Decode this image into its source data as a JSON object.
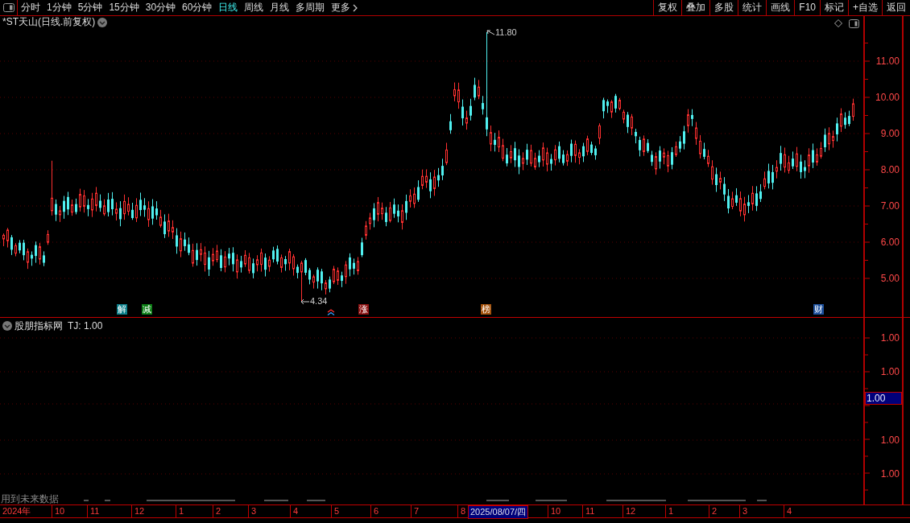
{
  "toolbar": {
    "periods": [
      {
        "label": "分时",
        "selected": false
      },
      {
        "label": "1分钟",
        "selected": false
      },
      {
        "label": "5分钟",
        "selected": false
      },
      {
        "label": "15分钟",
        "selected": false
      },
      {
        "label": "30分钟",
        "selected": false
      },
      {
        "label": "60分钟",
        "selected": false
      },
      {
        "label": "日线",
        "selected": true
      },
      {
        "label": "周线",
        "selected": false
      },
      {
        "label": "月线",
        "selected": false
      },
      {
        "label": "多周期",
        "selected": false
      }
    ],
    "more": "更多",
    "tools": [
      "复权",
      "叠加",
      "多股",
      "统计",
      "画线",
      "F10",
      "标记",
      "+自选",
      "返回"
    ]
  },
  "main_panel": {
    "title": "*ST天山(日线.前复权)",
    "price_axis": [
      "11.00",
      "10.00",
      "9.00",
      "8.00",
      "7.00",
      "6.00",
      "5.00"
    ],
    "high_marker": "11.80",
    "low_marker": "4.34",
    "events": [
      {
        "label": "解",
        "color": "#0b7f8a"
      },
      {
        "label": "减",
        "color": "#0b7d14"
      },
      {
        "label": "涨",
        "color": "#8a1010"
      },
      {
        "label": "榜",
        "color": "#a4520c"
      },
      {
        "label": "财",
        "color": "#1c4f9c"
      }
    ]
  },
  "indicator_panel": {
    "title": "股朋指标网",
    "reading": "TJ: 1.00",
    "axis": [
      "1.00",
      "1.00",
      "1.00",
      "1.00"
    ],
    "current": "1.00"
  },
  "footer_note": "用到未来数据",
  "date_axis": [
    {
      "label": "2024年",
      "selected": false
    },
    {
      "label": "10",
      "selected": false
    },
    {
      "label": "11",
      "selected": false
    },
    {
      "label": "12",
      "selected": false
    },
    {
      "label": "1",
      "selected": false
    },
    {
      "label": "2",
      "selected": false
    },
    {
      "label": "3",
      "selected": false
    },
    {
      "label": "4",
      "selected": false
    },
    {
      "label": "5",
      "selected": false
    },
    {
      "label": "6",
      "selected": false
    },
    {
      "label": "7",
      "selected": false
    },
    {
      "label": "8",
      "selected": false
    },
    {
      "label": "2025/08/07/四",
      "selected": true
    },
    {
      "label": "10",
      "selected": false
    },
    {
      "label": "11",
      "selected": false
    },
    {
      "label": "12",
      "selected": false
    },
    {
      "label": "1",
      "selected": false
    },
    {
      "label": "2",
      "selected": false
    },
    {
      "label": "3",
      "selected": false
    },
    {
      "label": "4",
      "selected": false
    }
  ]
}
